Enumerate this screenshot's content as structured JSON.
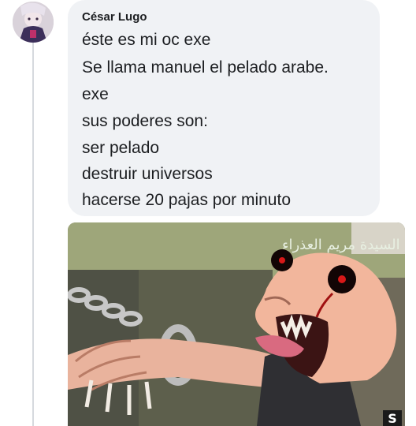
{
  "comment": {
    "author": "César Lugo",
    "lines": [
      "éste es mi oc exe",
      "Se llama manuel el pelado arabe.",
      "exe",
      "sus poderes son:",
      "ser pelado",
      "destruir universos",
      "hacerse 20 pajas por minuto"
    ]
  },
  "attachment": {
    "overlay_text": "انا السيدة مريم العذراء",
    "corner_text": "S"
  },
  "colors": {
    "bubble": "#f0f2f5",
    "text": "#1c1e21",
    "thread_line": "#d6d9de"
  }
}
